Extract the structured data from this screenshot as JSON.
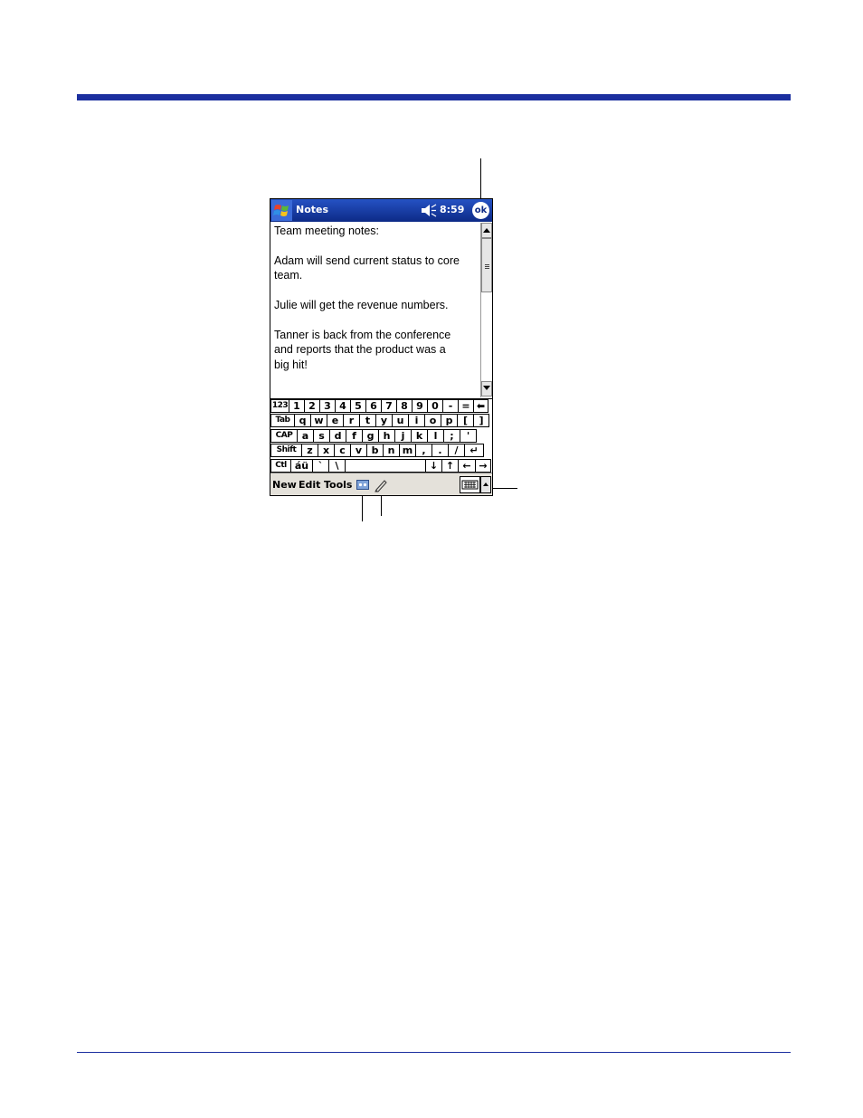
{
  "titlebar": {
    "app_name": "Notes",
    "time": "8:59",
    "ok_label": "ok"
  },
  "note": {
    "lines": [
      "Team meeting notes:",
      "",
      "Adam will send current status to core",
      "team.",
      "",
      "Julie will get the revenue numbers.",
      "",
      "Tanner is back from the conference",
      "and reports that the product was a",
      "big hit!"
    ]
  },
  "keyboard": {
    "row1": [
      "123",
      "1",
      "2",
      "3",
      "4",
      "5",
      "6",
      "7",
      "8",
      "9",
      "0",
      "-",
      "=",
      "⬅"
    ],
    "row2": [
      "Tab",
      "q",
      "w",
      "e",
      "r",
      "t",
      "y",
      "u",
      "i",
      "o",
      "p",
      "[",
      "]"
    ],
    "row3": [
      "CAP",
      "a",
      "s",
      "d",
      "f",
      "g",
      "h",
      "j",
      "k",
      "l",
      ";",
      "'"
    ],
    "row4": [
      "Shift",
      "z",
      "x",
      "c",
      "v",
      "b",
      "n",
      "m",
      ",",
      ".",
      "/",
      "↵"
    ],
    "row5": [
      "Ctl",
      "áü",
      "`",
      "\\",
      "",
      "↓",
      "↑",
      "←",
      "→"
    ]
  },
  "menubar": {
    "new": "New",
    "edit": "Edit",
    "tools": "Tools"
  },
  "icons": {
    "start": "windows-flag-icon",
    "volume": "speaker-icon",
    "recorder": "recording-toolbar-icon",
    "pen": "pen-icon",
    "input_panel": "keyboard-icon"
  },
  "colors": {
    "titlebar": "#0d2a86",
    "rule": "#1b2f9f",
    "menubar": "#e4e1da"
  }
}
